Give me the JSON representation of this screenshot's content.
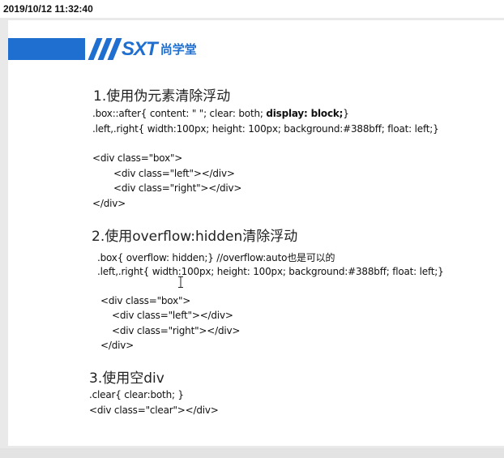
{
  "timestamp": "2019/10/12 11:32:40",
  "logo": {
    "mark": "SXT",
    "name": "尚学堂"
  },
  "sections": [
    {
      "heading": "1.使用伪元素清除浮动",
      "lines": [
        {
          "text_a": ".box::after{ content: \" \"; clear: both; ",
          "text_bold": "display: block;",
          "text_b": "}"
        },
        {
          "text": ".left,.right{ width:100px; height: 100px; background:#388bff; float: left;}"
        },
        {
          "text": "<div class=\"box\">"
        },
        {
          "text": "<div class=\"left\"></div>"
        },
        {
          "text": "<div class=\"right\"></div>"
        },
        {
          "text": "</div>"
        }
      ]
    },
    {
      "heading": "2.使用overflow:hidden清除浮动",
      "lines": [
        {
          "text": ".box{ overflow: hidden;}  //overflow:auto也是可以的"
        },
        {
          "text": ".left,.right{ width:100px; height: 100px; background:#388bff; float: left;}"
        },
        {
          "text": "<div class=\"box\">"
        },
        {
          "text": "<div class=\"left\"></div>"
        },
        {
          "text": "<div class=\"right\"></div>"
        },
        {
          "text": "</div>"
        }
      ]
    },
    {
      "heading": "3.使用空div",
      "lines": [
        {
          "text": ".clear{ clear:both; }"
        },
        {
          "text": "<div class=\"clear\"></div>"
        }
      ]
    }
  ],
  "colors": {
    "brand_blue": "#1f6fd1"
  }
}
